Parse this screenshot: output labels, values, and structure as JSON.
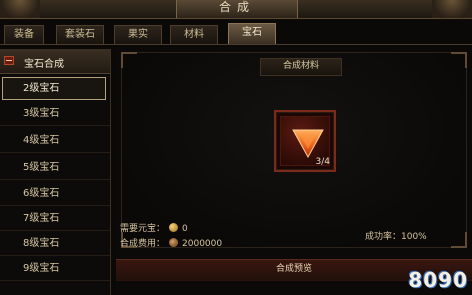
{
  "window": {
    "title": "合成"
  },
  "tabs": [
    {
      "label": "装备",
      "active": false
    },
    {
      "label": "套装石",
      "active": false
    },
    {
      "label": "果实",
      "active": false
    },
    {
      "label": "材料",
      "active": false
    },
    {
      "label": "宝石",
      "active": true
    }
  ],
  "sidebar": {
    "header": {
      "label": "宝石合成",
      "expanded": true
    },
    "items": [
      {
        "label": "2级宝石",
        "selected": true
      },
      {
        "label": "3级宝石",
        "selected": false
      },
      {
        "label": "4级宝石",
        "selected": false
      },
      {
        "label": "5级宝石",
        "selected": false
      },
      {
        "label": "6级宝石",
        "selected": false
      },
      {
        "label": "7级宝石",
        "selected": false
      },
      {
        "label": "8级宝石",
        "selected": false
      },
      {
        "label": "9级宝石",
        "selected": false
      }
    ]
  },
  "main": {
    "section_label": "合成材料",
    "material": {
      "icon": "red-gem-icon",
      "count": "3/4"
    },
    "yuanbao": {
      "label": "需要元宝：",
      "value": "0",
      "icon": "gold-ingot-icon"
    },
    "fee": {
      "label": "合成费用：",
      "value": "2000000",
      "icon": "copper-coin-icon"
    },
    "success_rate": "成功率：100%",
    "preview_bar": "合成预览"
  },
  "watermark": {
    "text": "8090"
  },
  "colors": {
    "accent_red": "#7c2a1a",
    "gem_orange": "#f07a2a",
    "text_gold": "#d9c9a3"
  }
}
